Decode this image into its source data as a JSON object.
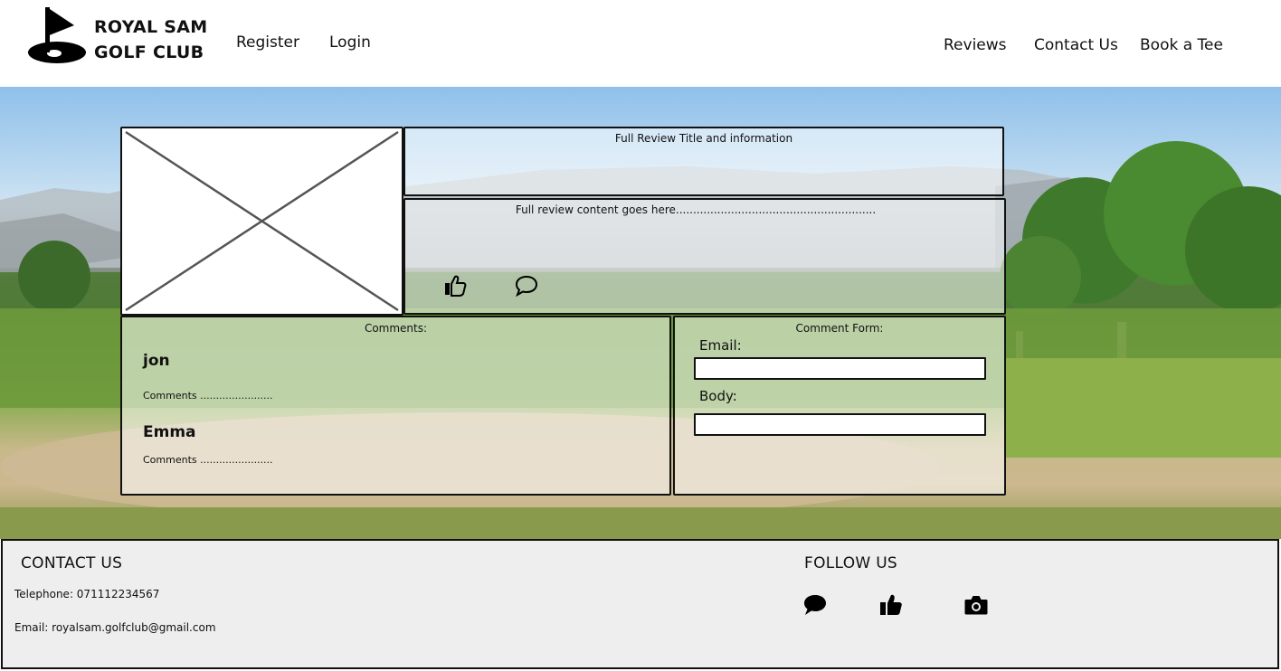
{
  "brand": {
    "line1": "ROYAL SAM",
    "line2": "GOLF CLUB",
    "logo_icon": "golf-flag-icon"
  },
  "nav": {
    "left": [
      {
        "label": "Register"
      },
      {
        "label": "Login"
      }
    ],
    "right": [
      {
        "label": "Reviews"
      },
      {
        "label": "Contact Us"
      },
      {
        "label": "Book a Tee"
      }
    ]
  },
  "review": {
    "title_info": "Full Review Title and information",
    "content": "Full review content goes here..........................................................",
    "like_icon": "thumbs-up-icon",
    "comment_icon": "speech-bubble-icon"
  },
  "comments": {
    "heading": "Comments:",
    "items": [
      {
        "name": "jon",
        "text": "Comments ......................."
      },
      {
        "name": "Emma",
        "text": "Comments ......................."
      }
    ]
  },
  "comment_form": {
    "heading": "Comment Form:",
    "email_label": "Email:",
    "body_label": "Body:",
    "email_value": "",
    "body_value": ""
  },
  "footer": {
    "contact_heading": "CONTACT US",
    "telephone": "Telephone: 071112234567",
    "email": "Email: royalsam.golfclub@gmail.com",
    "follow_heading": "FOLLOW US",
    "social_icons": [
      "chat-bubble-icon",
      "thumbs-up-icon",
      "camera-icon"
    ]
  },
  "colors": {
    "outline": "#111111",
    "footer_bg": "#eeeeee"
  }
}
